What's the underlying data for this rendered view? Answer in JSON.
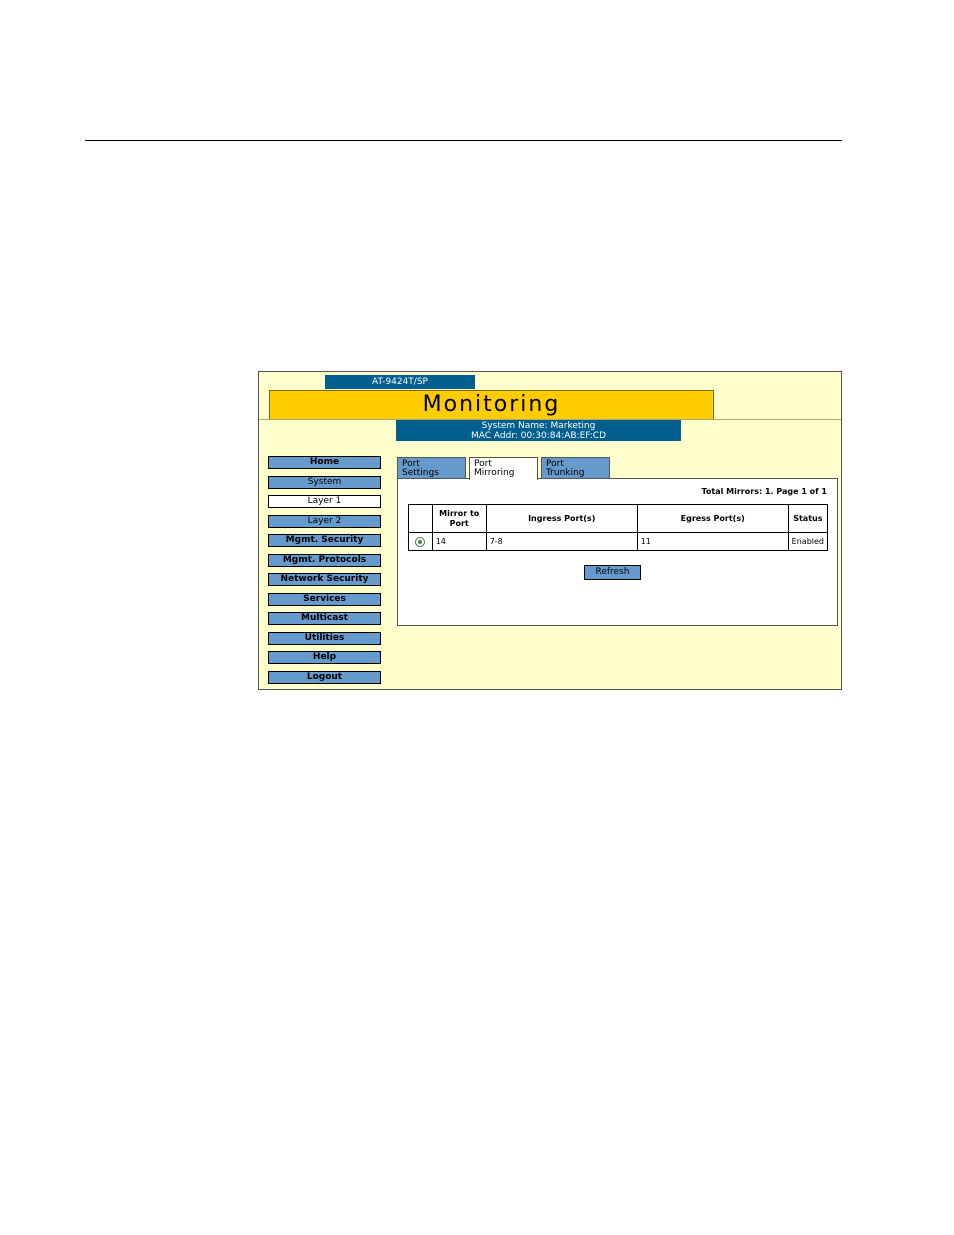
{
  "header": {
    "model": "AT-9424T/SP",
    "title": "Monitoring",
    "system_name": "System Name: Marketing",
    "mac_addr": "MAC Addr: 00:30:84:AB:EF:CD"
  },
  "nav": {
    "items": [
      {
        "label": "Home"
      },
      {
        "label": "System"
      },
      {
        "label": "Layer 1"
      },
      {
        "label": "Layer 2"
      },
      {
        "label": "Mgmt. Security"
      },
      {
        "label": "Mgmt. Protocols"
      },
      {
        "label": "Network Security"
      },
      {
        "label": "Services"
      },
      {
        "label": "Multicast"
      },
      {
        "label": "Utilities"
      },
      {
        "label": "Help"
      },
      {
        "label": "Logout"
      }
    ],
    "active": "Layer 1"
  },
  "tabs": [
    {
      "line1": "Port",
      "line2": "Settings"
    },
    {
      "line1": "Port",
      "line2": "Mirroring"
    },
    {
      "line1": "Port",
      "line2": "Trunking"
    }
  ],
  "panel": {
    "total": "Total Mirrors: 1. Page 1 of 1",
    "columns": {
      "mirror_line1": "Mirror to",
      "mirror_line2": "Port",
      "ingress": "Ingress Port(s)",
      "egress": "Egress Port(s)",
      "status": "Status"
    },
    "rows": [
      {
        "mirror": "14",
        "ingress": "7-8",
        "egress": "11",
        "status": "Enabled"
      }
    ],
    "refresh_label": "Refresh"
  }
}
